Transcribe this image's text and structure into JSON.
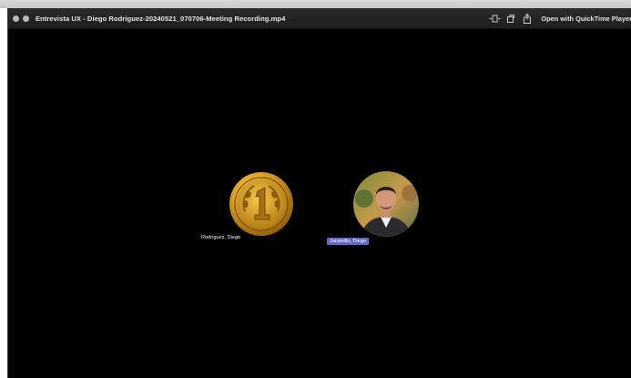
{
  "window": {
    "title": "Entrevista UX - Diego Rodriguez-20240521_070706-Meeting Recording.mp4",
    "open_with_label": "Open with QuickTime Player",
    "toolbar_icons": [
      "adjust-icon",
      "rotate-icon",
      "share-icon"
    ]
  },
  "participants": [
    {
      "name": "Rodriguez, Diego",
      "avatar": "gold-medal-number-1",
      "highlighted": false
    },
    {
      "name": "Jaramillo, Diego",
      "avatar": "person-photo",
      "highlighted": true
    }
  ],
  "colors": {
    "video_background": "#000000",
    "titlebar": "#242424",
    "active_speaker_label": "#6466c8",
    "medal_gold": "#d9a320"
  }
}
